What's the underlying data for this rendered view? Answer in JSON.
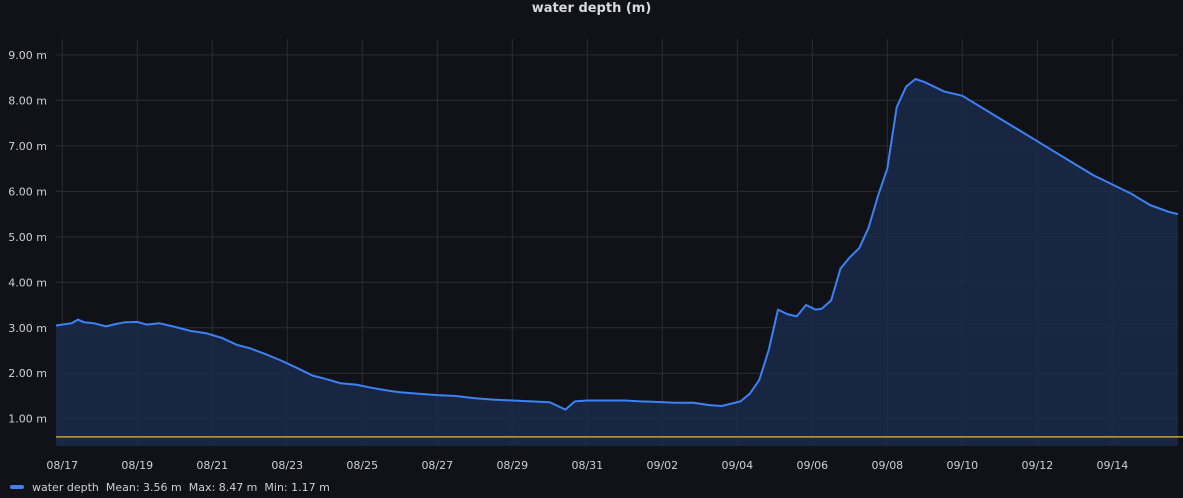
{
  "panel": {
    "title": "water depth (m)"
  },
  "colors": {
    "background": "#111217",
    "grid": "#2b2d33",
    "series": "#3b82f6",
    "fill": "#1b2a4a",
    "threshold": "#c9a227",
    "tick_text": "#c7d0d9"
  },
  "legend": {
    "series_name": "water depth",
    "mean": "Mean: 3.56 m",
    "max": "Max: 8.47 m",
    "min": "Min: 1.17 m"
  },
  "chart_data": {
    "type": "area",
    "title": "water depth (m)",
    "xlabel": "",
    "ylabel": "",
    "y_unit": "m",
    "xlim": [
      "08-16 20:00",
      "09-15 18:00"
    ],
    "ylim": [
      0.4,
      9.35
    ],
    "y_ticks": [
      1,
      2,
      3,
      4,
      5,
      6,
      7,
      8,
      9
    ],
    "y_tick_labels": [
      "1.00 m",
      "2.00 m",
      "3.00 m",
      "4.00 m",
      "5.00 m",
      "6.00 m",
      "7.00 m",
      "8.00 m",
      "9.00 m"
    ],
    "x_ticks": [
      "08-17",
      "08-19",
      "08-21",
      "08-23",
      "08-25",
      "08-27",
      "08-29",
      "08-31",
      "09-02",
      "09-04",
      "09-06",
      "09-08",
      "09-10",
      "09-12",
      "09-14"
    ],
    "x_tick_labels": [
      "08/17",
      "08/19",
      "08/21",
      "08/23",
      "08/25",
      "08/27",
      "08/29",
      "08/31",
      "09/02",
      "09/04",
      "09/06",
      "09/08",
      "09/10",
      "09/12",
      "09/14"
    ],
    "grid": true,
    "legend_position": "bottom-left",
    "threshold": 0.6,
    "series": [
      {
        "name": "water depth",
        "x": [
          "08-16 20:00",
          "08-17 06:00",
          "08-17 10:00",
          "08-17 14:00",
          "08-17 20:00",
          "08-18 04:00",
          "08-18 10:00",
          "08-18 16:00",
          "08-19 00:00",
          "08-19 06:00",
          "08-19 14:00",
          "08-20 00:00",
          "08-20 10:00",
          "08-20 20:00",
          "08-21 06:00",
          "08-21 16:00",
          "08-22 00:00",
          "08-22 10:00",
          "08-22 20:00",
          "08-23 06:00",
          "08-23 16:00",
          "08-24 00:00",
          "08-24 10:00",
          "08-24 20:00",
          "08-25 06:00",
          "08-25 16:00",
          "08-26 00:00",
          "08-26 12:00",
          "08-27 00:00",
          "08-27 12:00",
          "08-28 00:00",
          "08-28 12:00",
          "08-29 00:00",
          "08-29 12:00",
          "08-30 00:00",
          "08-30 10:00",
          "08-30 16:00",
          "08-31 00:00",
          "08-31 12:00",
          "09-01 00:00",
          "09-01 10:00",
          "09-01 20:00",
          "09-02 08:00",
          "09-02 20:00",
          "09-03 06:00",
          "09-03 14:00",
          "09-03 20:00",
          "09-04 02:00",
          "09-04 08:00",
          "09-04 14:00",
          "09-04 20:00",
          "09-05 02:00",
          "09-05 08:00",
          "09-05 14:00",
          "09-05 20:00",
          "09-06 02:00",
          "09-06 06:00",
          "09-06 12:00",
          "09-06 18:00",
          "09-07 00:00",
          "09-07 06:00",
          "09-07 12:00",
          "09-07 18:00",
          "09-08 00:00",
          "09-08 06:00",
          "09-08 12:00",
          "09-08 18:00",
          "09-09 00:00",
          "09-09 06:00",
          "09-09 12:00",
          "09-10 00:00",
          "09-10 12:00",
          "09-11 00:00",
          "09-11 12:00",
          "09-12 00:00",
          "09-12 12:00",
          "09-13 00:00",
          "09-13 12:00",
          "09-14 00:00",
          "09-14 12:00",
          "09-15 00:00",
          "09-15 12:00",
          "09-15 18:00"
        ],
        "values": [
          3.05,
          3.1,
          3.18,
          3.12,
          3.1,
          3.03,
          3.08,
          3.12,
          3.13,
          3.07,
          3.1,
          3.02,
          2.93,
          2.88,
          2.78,
          2.62,
          2.55,
          2.42,
          2.28,
          2.12,
          1.95,
          1.88,
          1.78,
          1.75,
          1.68,
          1.62,
          1.58,
          1.55,
          1.52,
          1.5,
          1.45,
          1.42,
          1.4,
          1.38,
          1.36,
          1.2,
          1.38,
          1.4,
          1.4,
          1.4,
          1.38,
          1.37,
          1.35,
          1.35,
          1.3,
          1.28,
          1.33,
          1.38,
          1.55,
          1.85,
          2.5,
          3.4,
          3.3,
          3.25,
          3.5,
          3.4,
          3.42,
          3.6,
          4.3,
          4.55,
          4.75,
          5.2,
          5.9,
          6.5,
          7.85,
          8.3,
          8.47,
          8.4,
          8.3,
          8.2,
          8.1,
          7.85,
          7.6,
          7.35,
          7.1,
          6.85,
          6.6,
          6.35,
          6.15,
          5.95,
          5.7,
          5.55,
          5.5
        ]
      }
    ]
  }
}
